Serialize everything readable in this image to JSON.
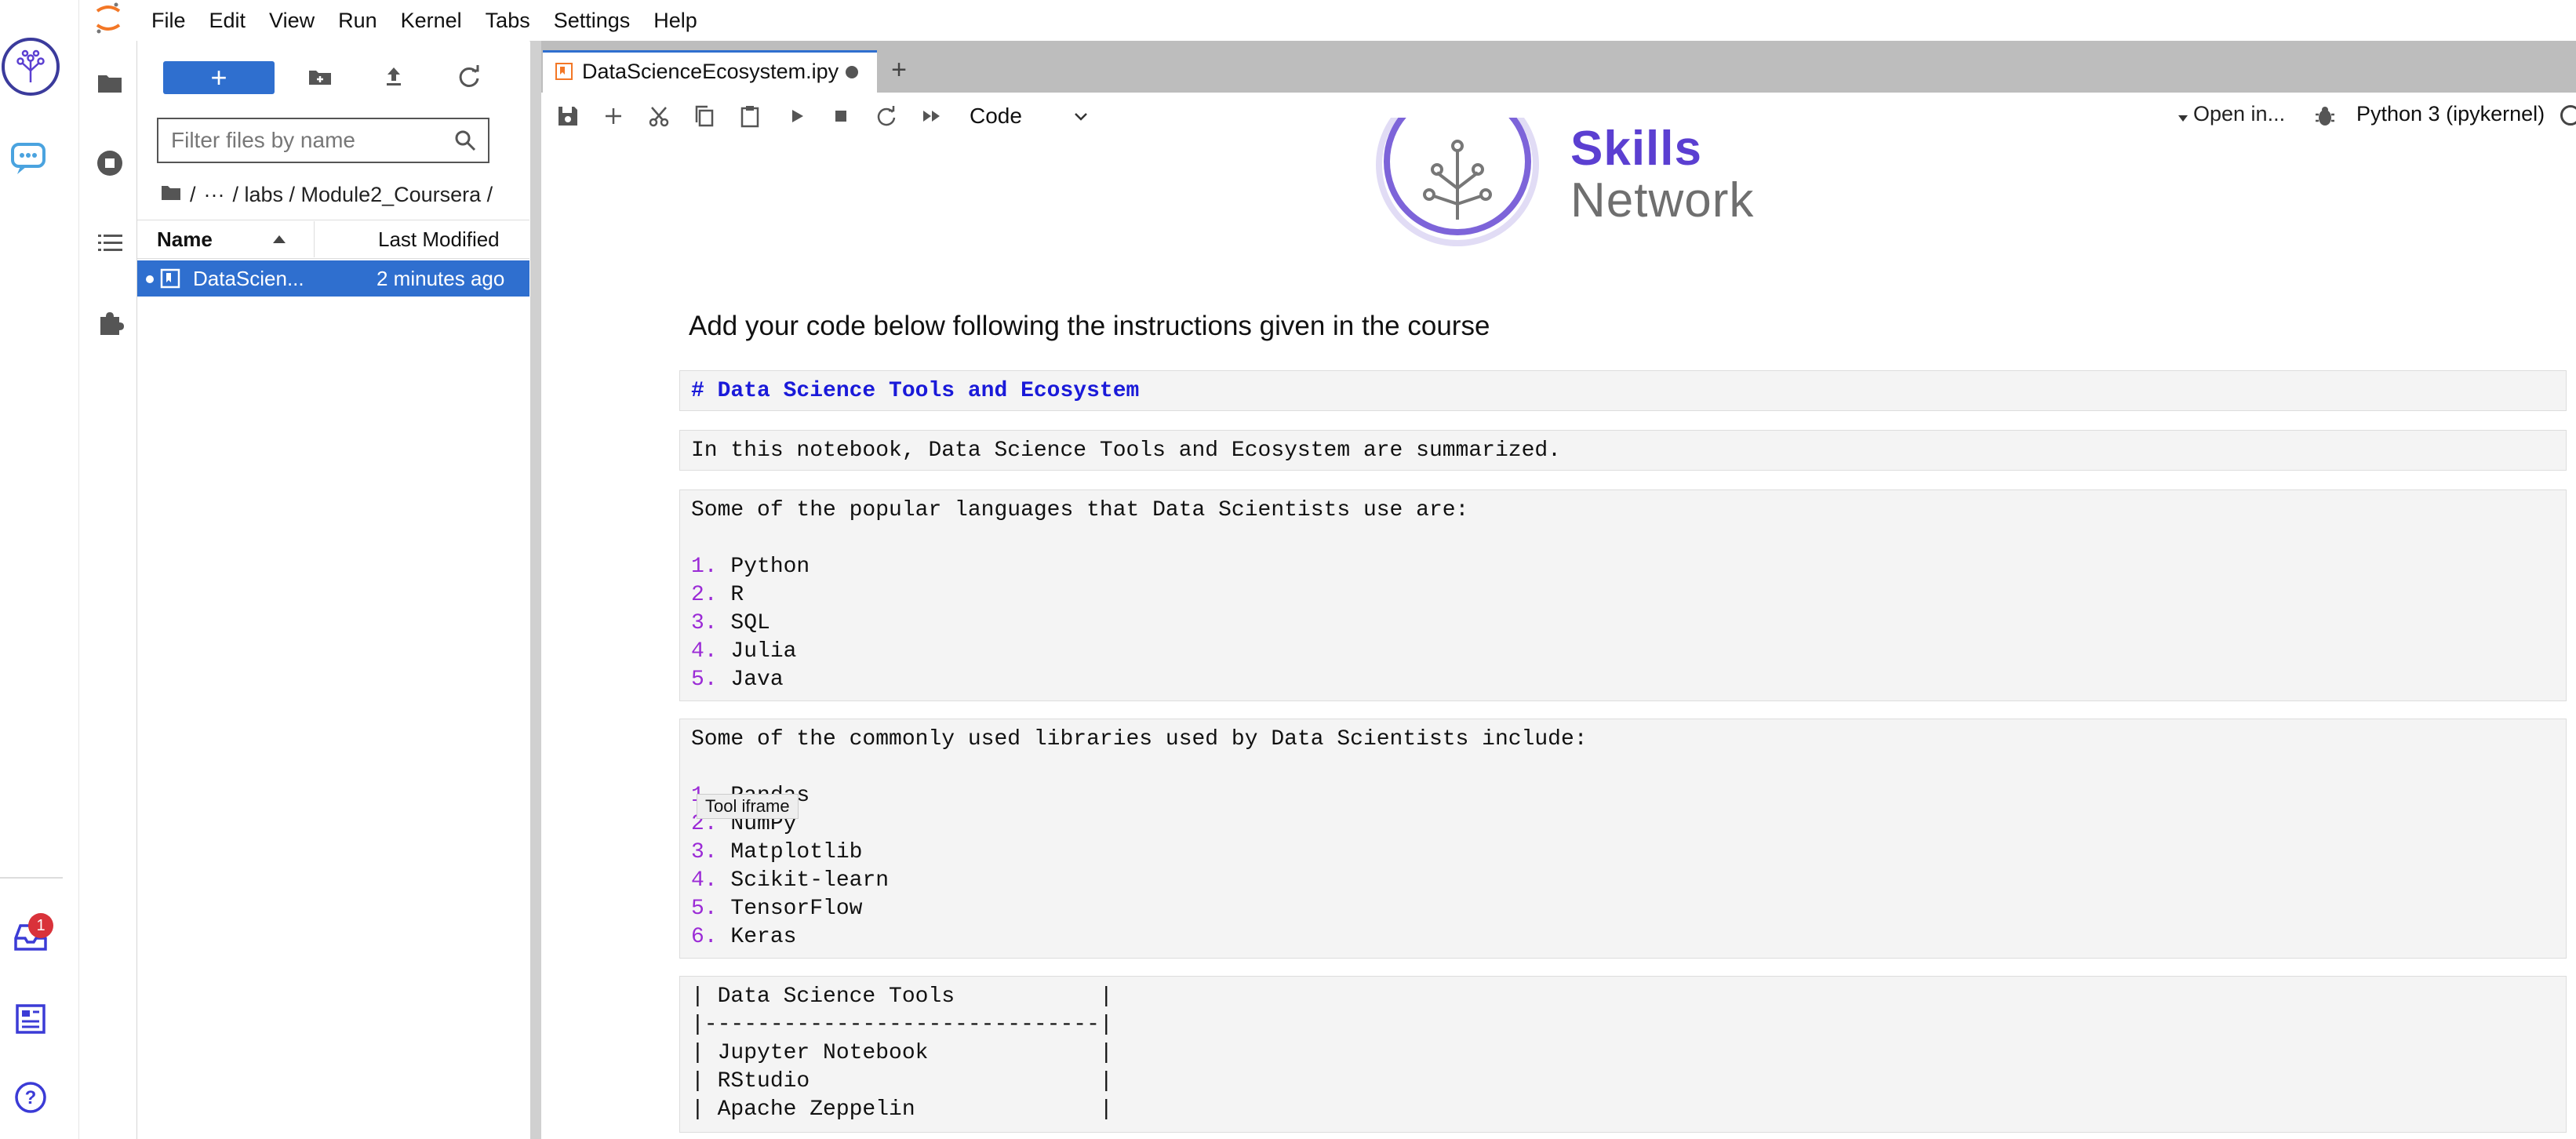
{
  "menubar": {
    "items": [
      "File",
      "Edit",
      "View",
      "Run",
      "Kernel",
      "Tabs",
      "Settings",
      "Help"
    ]
  },
  "sn_strip": {
    "inbox_badge": "1"
  },
  "filebrowser": {
    "new_label": "+",
    "filter_placeholder": "Filter files by name",
    "breadcrumb": [
      "/",
      "···",
      "/ labs / Module2_Coursera /"
    ],
    "columns": {
      "name": "Name",
      "modified": "Last Modified"
    },
    "files": [
      {
        "name": "DataScien...",
        "modified": "2 minutes ago"
      }
    ]
  },
  "tab": {
    "title": "DataScienceEcosystem.ipy",
    "add": "+"
  },
  "toolbar": {
    "cell_type": "Code",
    "open_in": "Open in...",
    "kernel": "Python 3 (ipykernel)"
  },
  "notebook": {
    "logo_skills": "Skills",
    "logo_network": "Network",
    "instructions": "Add your code below following the instructions given in the course",
    "cell1": "# Data Science Tools and Ecosystem",
    "cell2": "In this notebook, Data Science Tools and Ecosystem are summarized.",
    "cell3": {
      "intro": "Some of the popular languages that Data Scientists use are:",
      "items": [
        "Python",
        "R",
        "SQL",
        "Julia",
        "Java"
      ]
    },
    "cell4": {
      "intro": "Some of the commonly used libraries used by Data Scientists include:",
      "items": [
        "Pandas",
        "NumPy",
        "Matplotlib",
        "Scikit-learn",
        "TensorFlow",
        "Keras"
      ]
    },
    "cell5": {
      "lines": [
        "| Data Science Tools           |",
        "|------------------------------|",
        "| Jupyter Notebook             |",
        "| RStudio                      |",
        "| Apache Zeppelin              |"
      ]
    },
    "tooltip": "Tool iframe"
  },
  "colors": {
    "accent": "#2f6fcf",
    "list_number": "#9b2bd6",
    "heading_blue": "#1a1ad9",
    "brand_purple": "#5b3fd1"
  }
}
